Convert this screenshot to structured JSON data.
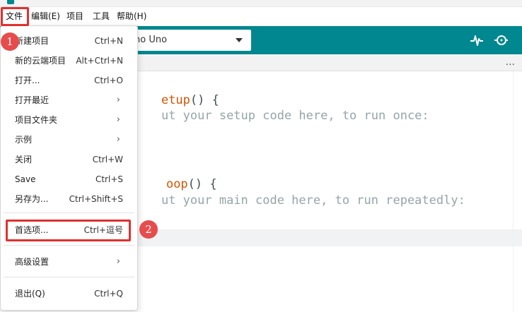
{
  "menubar": {
    "items": [
      "文件",
      "编辑(E)",
      "项目",
      "工具",
      "帮助(H)"
    ]
  },
  "toolbar": {
    "board_label": "no Uno",
    "icons": [
      "serial-plotter-icon",
      "serial-monitor-icon"
    ]
  },
  "tabstrip": {
    "more": "..."
  },
  "editor": {
    "lines": [
      {
        "kw": "etup",
        "rest": "() {"
      },
      {
        "comment": "ut your setup code here, to run once:"
      },
      {
        "kw": "oop",
        "rest": "() {"
      },
      {
        "comment": "ut your main code here, to run repeatedly:"
      }
    ]
  },
  "file_menu": {
    "items": [
      {
        "label": "新建项目",
        "shortcut": "Ctrl+N"
      },
      {
        "label": "新的云端项目",
        "shortcut": "Alt+Ctrl+N"
      },
      {
        "label": "打开...",
        "shortcut": "Ctrl+O"
      },
      {
        "label": "打开最近",
        "submenu": "›"
      },
      {
        "label": "项目文件夹",
        "submenu": "›"
      },
      {
        "label": "示例",
        "submenu": "›"
      },
      {
        "label": "关闭",
        "shortcut": "Ctrl+W"
      },
      {
        "label": "Save",
        "shortcut": "Ctrl+S"
      },
      {
        "label": "另存为...",
        "shortcut": "Ctrl+Shift+S"
      },
      {
        "label": "首选项...",
        "shortcut": "Ctrl+逗号"
      },
      {
        "label": "高级设置",
        "submenu": "›"
      },
      {
        "label": "退出(Q)",
        "shortcut": "Ctrl+Q"
      }
    ]
  },
  "annotations": {
    "step1": "1",
    "step2": "2",
    "highlight_color": "#e0312f",
    "badge_color": "#e74c4c"
  },
  "colors": {
    "toolbar": "#00878f",
    "keyword": "#d35400",
    "comment": "#95a5a6"
  }
}
